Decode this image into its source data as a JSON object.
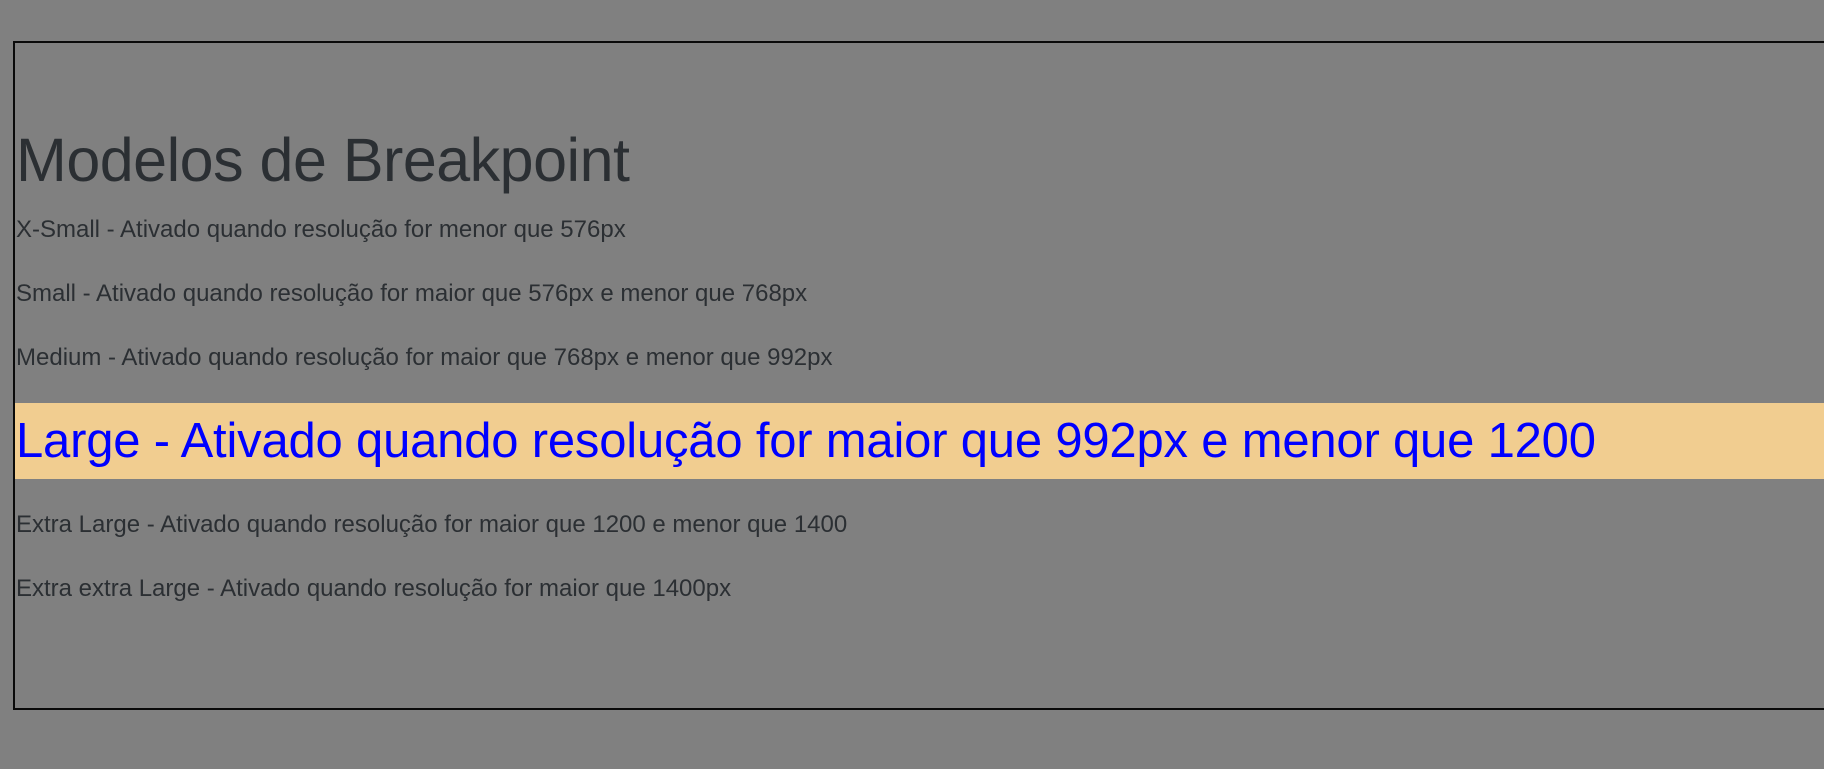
{
  "page": {
    "title": "Modelos de Breakpoint",
    "background_color": "#808080",
    "active_highlight_color": "#f1cd90",
    "active_text_color": "#0000ff",
    "text_color": "#2b2f33"
  },
  "breakpoints": {
    "xsmall": "X-Small - Ativado quando resolução for menor que 576px",
    "small": "Small - Ativado quando resolução for maior que 576px e menor que 768px",
    "medium": "Medium - Ativado quando resolução for maior que 768px e menor que 992px",
    "large": "Large - Ativado quando resolução for maior que 992px e menor que 1200",
    "xlarge": "Extra Large - Ativado quando resolução for maior que 1200 e menor que 1400",
    "xxlarge": "Extra extra Large - Ativado quando resolução for maior que 1400px"
  }
}
